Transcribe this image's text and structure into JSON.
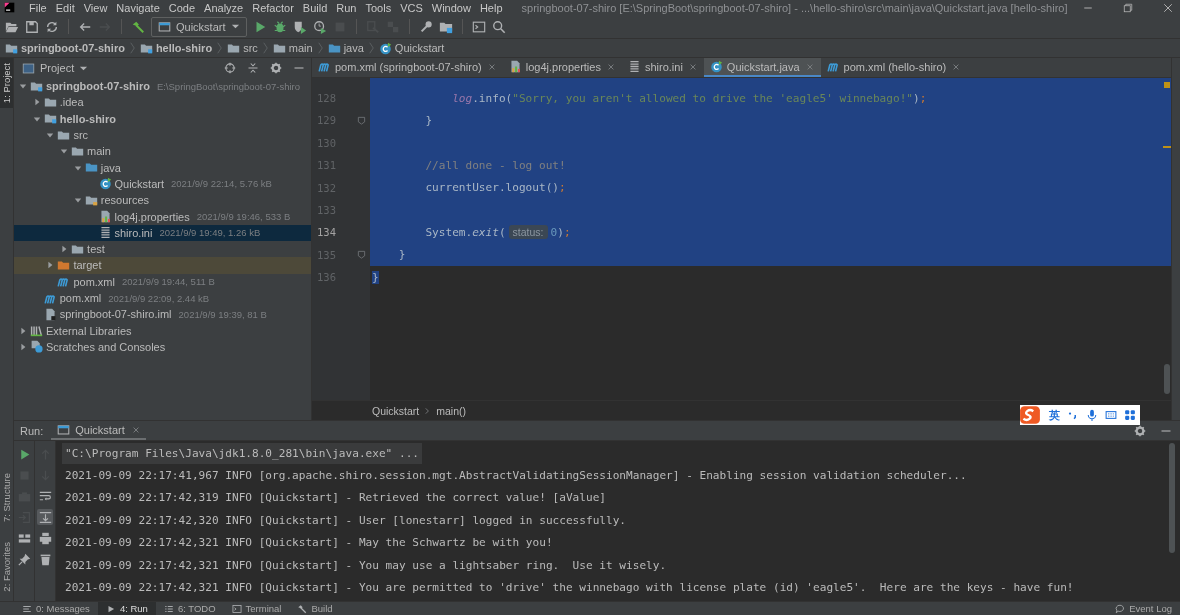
{
  "menu": [
    "File",
    "Edit",
    "View",
    "Navigate",
    "Code",
    "Analyze",
    "Refactor",
    "Build",
    "Run",
    "Tools",
    "VCS",
    "Window",
    "Help"
  ],
  "window_title": "springboot-07-shiro [E:\\SpringBoot\\springboot-07-shiro] - ...\\hello-shiro\\src\\main\\java\\Quickstart.java [hello-shiro]",
  "toolbar": [
    {
      "kind": "open",
      "disabled": false
    },
    {
      "kind": "save",
      "disabled": false
    },
    {
      "kind": "sync",
      "disabled": false
    },
    {
      "kind": "separator"
    },
    {
      "kind": "back",
      "disabled": false
    },
    {
      "kind": "forward",
      "disabled": true
    },
    {
      "kind": "separator"
    },
    {
      "kind": "build",
      "disabled": false
    },
    {
      "kind": "config"
    },
    {
      "kind": "run",
      "disabled": false
    },
    {
      "kind": "debug",
      "disabled": false
    },
    {
      "kind": "coverage",
      "disabled": false
    },
    {
      "kind": "profile",
      "disabled": false
    },
    {
      "kind": "stop",
      "disabled": true
    },
    {
      "kind": "separator"
    },
    {
      "kind": "attach",
      "disabled": true
    },
    {
      "kind": "cubes",
      "disabled": true
    },
    {
      "kind": "separator"
    },
    {
      "kind": "wrench",
      "disabled": false
    },
    {
      "kind": "structure",
      "disabled": false
    },
    {
      "kind": "separator"
    },
    {
      "kind": "terminal",
      "disabled": false
    },
    {
      "kind": "search",
      "disabled": false
    }
  ],
  "run_config": "Quickstart",
  "nav_bar": [
    {
      "label": "springboot-07-shiro",
      "kind": "module"
    },
    {
      "label": "hello-shiro",
      "kind": "module"
    },
    {
      "label": "src",
      "kind": "folder"
    },
    {
      "label": "main",
      "kind": "folder"
    },
    {
      "label": "java",
      "kind": "source-folder"
    },
    {
      "label": "Quickstart",
      "kind": "java-class"
    }
  ],
  "left_strip": {
    "top": [
      {
        "label": "1: Project",
        "selected": true
      }
    ],
    "bottom": [
      {
        "label": "7: Structure",
        "selected": false
      },
      {
        "label": "2: Favorites",
        "selected": false
      }
    ]
  },
  "project": {
    "title": "Project",
    "tree": [
      {
        "name": "springboot-07-shiro",
        "info": "E:\\SpringBoot\\springboot-07-shiro",
        "kind": "module",
        "expanded": true,
        "selected": false,
        "hovered": false,
        "children": [
          {
            "name": ".idea",
            "kind": "folder",
            "expanded": false,
            "selected": false,
            "hovered": false
          },
          {
            "name": "hello-shiro",
            "kind": "module",
            "expanded": true,
            "selected": false,
            "hovered": false,
            "children": [
              {
                "name": "src",
                "kind": "folder",
                "expanded": true,
                "selected": false,
                "hovered": false,
                "children": [
                  {
                    "name": "main",
                    "kind": "folder",
                    "expanded": true,
                    "selected": false,
                    "hovered": false,
                    "children": [
                      {
                        "name": "java",
                        "kind": "source-folder",
                        "expanded": true,
                        "selected": false,
                        "hovered": false,
                        "children": [
                          {
                            "name": "Quickstart",
                            "info": "2021/9/9 22:14, 5.76 kB",
                            "kind": "java-class",
                            "selected": false,
                            "hovered": false
                          }
                        ]
                      },
                      {
                        "name": "resources",
                        "kind": "resources-folder",
                        "expanded": true,
                        "selected": false,
                        "hovered": false,
                        "children": [
                          {
                            "name": "log4j.properties",
                            "info": "2021/9/9 19:46, 533 B",
                            "kind": "properties",
                            "selected": false,
                            "hovered": false
                          },
                          {
                            "name": "shiro.ini",
                            "info": "2021/9/9 19:49, 1.26 kB",
                            "kind": "ini",
                            "selected": true,
                            "hovered": false
                          }
                        ]
                      }
                    ]
                  },
                  {
                    "name": "test",
                    "kind": "folder",
                    "expanded": false,
                    "selected": false,
                    "hovered": false
                  }
                ]
              },
              {
                "name": "target",
                "kind": "excluded-folder",
                "expanded": false,
                "selected": false,
                "hovered": true
              },
              {
                "name": "pom.xml",
                "info": "2021/9/9 19:44, 511 B",
                "kind": "maven",
                "selected": false,
                "hovered": false
              }
            ]
          },
          {
            "name": "pom.xml",
            "info": "2021/9/9 22:09, 2.44 kB",
            "kind": "maven",
            "selected": false,
            "hovered": false
          },
          {
            "name": "springboot-07-shiro.iml",
            "info": "2021/9/9 19:39, 81 B",
            "kind": "iml",
            "selected": false,
            "hovered": false
          }
        ]
      },
      {
        "name": "External Libraries",
        "kind": "libraries",
        "expanded": false,
        "selected": false,
        "hovered": false
      },
      {
        "name": "Scratches and Consoles",
        "kind": "scratches",
        "expanded": false,
        "selected": false,
        "hovered": false
      }
    ]
  },
  "editor": {
    "tabs": [
      {
        "label": "pom.xml (springboot-07-shiro)",
        "kind": "maven",
        "selected": false
      },
      {
        "label": "log4j.properties",
        "kind": "properties",
        "selected": false
      },
      {
        "label": "shiro.ini",
        "kind": "ini",
        "selected": false
      },
      {
        "label": "Quickstart.java",
        "kind": "java-class",
        "selected": true
      },
      {
        "label": "pom.xml (hello-shiro)",
        "kind": "maven",
        "selected": false
      }
    ],
    "lines": [
      {
        "number": "128",
        "current": false,
        "selected": true,
        "fold": false,
        "tokens": [
          {
            "text": "            log",
            "kind": "field"
          },
          {
            "text": ".info(",
            "kind": "plain"
          },
          {
            "text": "\"Sorry, you aren't allowed to drive the 'eagle5' winnebago!\"",
            "kind": "string"
          },
          {
            "text": ")",
            "kind": "plain"
          },
          {
            "text": ";",
            "kind": "keyword"
          }
        ]
      },
      {
        "number": "129",
        "current": false,
        "selected": true,
        "fold": true,
        "tokens": [
          {
            "text": "        }",
            "kind": "plain"
          }
        ]
      },
      {
        "number": "130",
        "current": false,
        "selected": true,
        "fold": false
      },
      {
        "number": "131",
        "current": false,
        "selected": true,
        "fold": false,
        "tokens": [
          {
            "text": "        //all done - log out!",
            "kind": "comment"
          }
        ]
      },
      {
        "number": "132",
        "current": false,
        "selected": true,
        "fold": false,
        "tokens": [
          {
            "text": "        currentUser.logout()",
            "kind": "plain"
          },
          {
            "text": ";",
            "kind": "keyword"
          }
        ]
      },
      {
        "number": "133",
        "current": false,
        "selected": true,
        "fold": false
      },
      {
        "number": "134",
        "current": true,
        "selected": true,
        "fold": false,
        "tokens": [
          {
            "text": "        System.",
            "kind": "plain"
          },
          {
            "text": "exit",
            "kind": "static"
          },
          {
            "text": "(",
            "kind": "plain"
          },
          {
            "text": "status:",
            "kind": "hint"
          },
          {
            "text": "0",
            "kind": "number"
          },
          {
            "text": ")",
            "kind": "plain"
          },
          {
            "text": ";",
            "kind": "keyword"
          }
        ]
      },
      {
        "number": "135",
        "current": false,
        "selected": true,
        "fold": true,
        "tokens": [
          {
            "text": "    }",
            "kind": "plain"
          }
        ]
      },
      {
        "number": "136",
        "current": false,
        "selected": false,
        "fold": false,
        "tokens": [
          {
            "text": "}",
            "kind": "selected"
          }
        ]
      }
    ],
    "breadcrumb": [
      "Quickstart",
      "main()"
    ]
  },
  "ime": {
    "mode": "英"
  },
  "run": {
    "label": "Run:",
    "tab": "Quickstart",
    "tools": [
      [
        {
          "kind": "rerun",
          "disabled": false,
          "active": false
        },
        {
          "kind": "stop",
          "disabled": true,
          "active": false
        },
        {
          "kind": "camera",
          "disabled": true,
          "active": false
        },
        {
          "kind": "enter",
          "disabled": true,
          "active": false
        },
        {
          "kind": "layout",
          "disabled": false,
          "active": false
        },
        {
          "kind": "pin",
          "disabled": false,
          "active": false
        }
      ],
      [
        {
          "kind": "up",
          "disabled": true,
          "active": false
        },
        {
          "kind": "down",
          "disabled": true,
          "active": false
        },
        {
          "kind": "wrap",
          "disabled": false,
          "active": false
        },
        {
          "kind": "scroll-end",
          "disabled": false,
          "active": true
        },
        {
          "kind": "print",
          "disabled": false,
          "active": false
        },
        {
          "kind": "trash",
          "disabled": false,
          "active": false
        }
      ]
    ],
    "console": [
      {
        "kind": "command",
        "text": "\"C:\\Program Files\\Java\\jdk1.8.0_281\\bin\\java.exe\" ..."
      },
      {
        "kind": "output",
        "text": "2021-09-09 22:17:41,967 INFO [org.apache.shiro.session.mgt.AbstractValidatingSessionManager] - Enabling session validation scheduler..."
      },
      {
        "kind": "output",
        "text": "2021-09-09 22:17:42,319 INFO [Quickstart] - Retrieved the correct value! [aValue]"
      },
      {
        "kind": "output",
        "text": "2021-09-09 22:17:42,320 INFO [Quickstart] - User [lonestarr] logged in successfully."
      },
      {
        "kind": "output",
        "text": "2021-09-09 22:17:42,321 INFO [Quickstart] - May the Schwartz be with you!"
      },
      {
        "kind": "output",
        "text": "2021-09-09 22:17:42,321 INFO [Quickstart] - You may use a lightsaber ring.  Use it wisely."
      },
      {
        "kind": "output",
        "text": "2021-09-09 22:17:42,321 INFO [Quickstart] - You are permitted to 'drive' the winnebago with license plate (id) 'eagle5'.  Here are the keys - have fun!"
      }
    ]
  },
  "status_bar": {
    "tabs": [
      {
        "label": "0: Messages",
        "kind": "messages",
        "selected": false
      },
      {
        "label": "4: Run",
        "kind": "run",
        "selected": true
      },
      {
        "label": "6: TODO",
        "kind": "todo",
        "selected": false
      },
      {
        "label": "Terminal",
        "kind": "terminal",
        "selected": false
      },
      {
        "label": "Build",
        "kind": "build",
        "selected": false
      }
    ],
    "event_log": "Event Log"
  }
}
